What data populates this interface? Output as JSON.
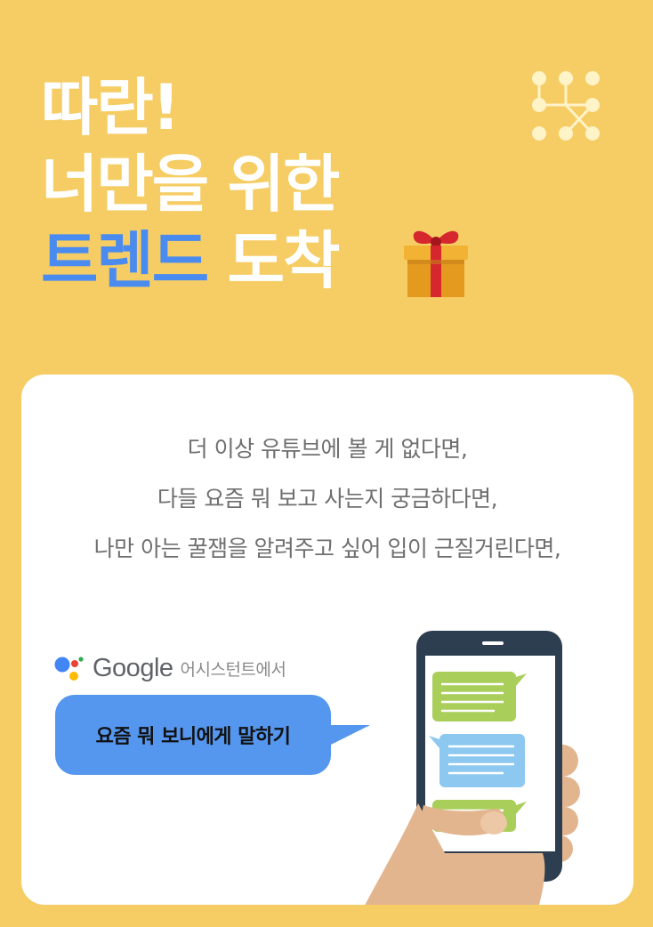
{
  "headline": {
    "line1": "따란!",
    "line2": "너만을 위한",
    "line3_accent": "트렌드",
    "line3_rest": " 도착"
  },
  "card": {
    "intro_lines": [
      "더 이상 유튜브에 볼 게 없다면,",
      "다들 요즘 뭐 보고 사는지 궁금하다면,",
      "나만 아는 꿀잼을 알려주고 싶어 입이 근질거린다면,"
    ],
    "assistant": {
      "brand": "Google",
      "suffix": "어시스턴트에서"
    },
    "command": "요즘 뭐 보니에게 말하기"
  },
  "colors": {
    "background": "#F6CD64",
    "accent_blue": "#4A8BF0",
    "bubble_blue": "#5596EE",
    "chat_green": "#A9CE5A",
    "chat_blue": "#8CC8EF"
  },
  "icons": {
    "gift": "gift-box-icon",
    "logo": "molecule-logo-icon",
    "assistant": "google-assistant-icon"
  }
}
